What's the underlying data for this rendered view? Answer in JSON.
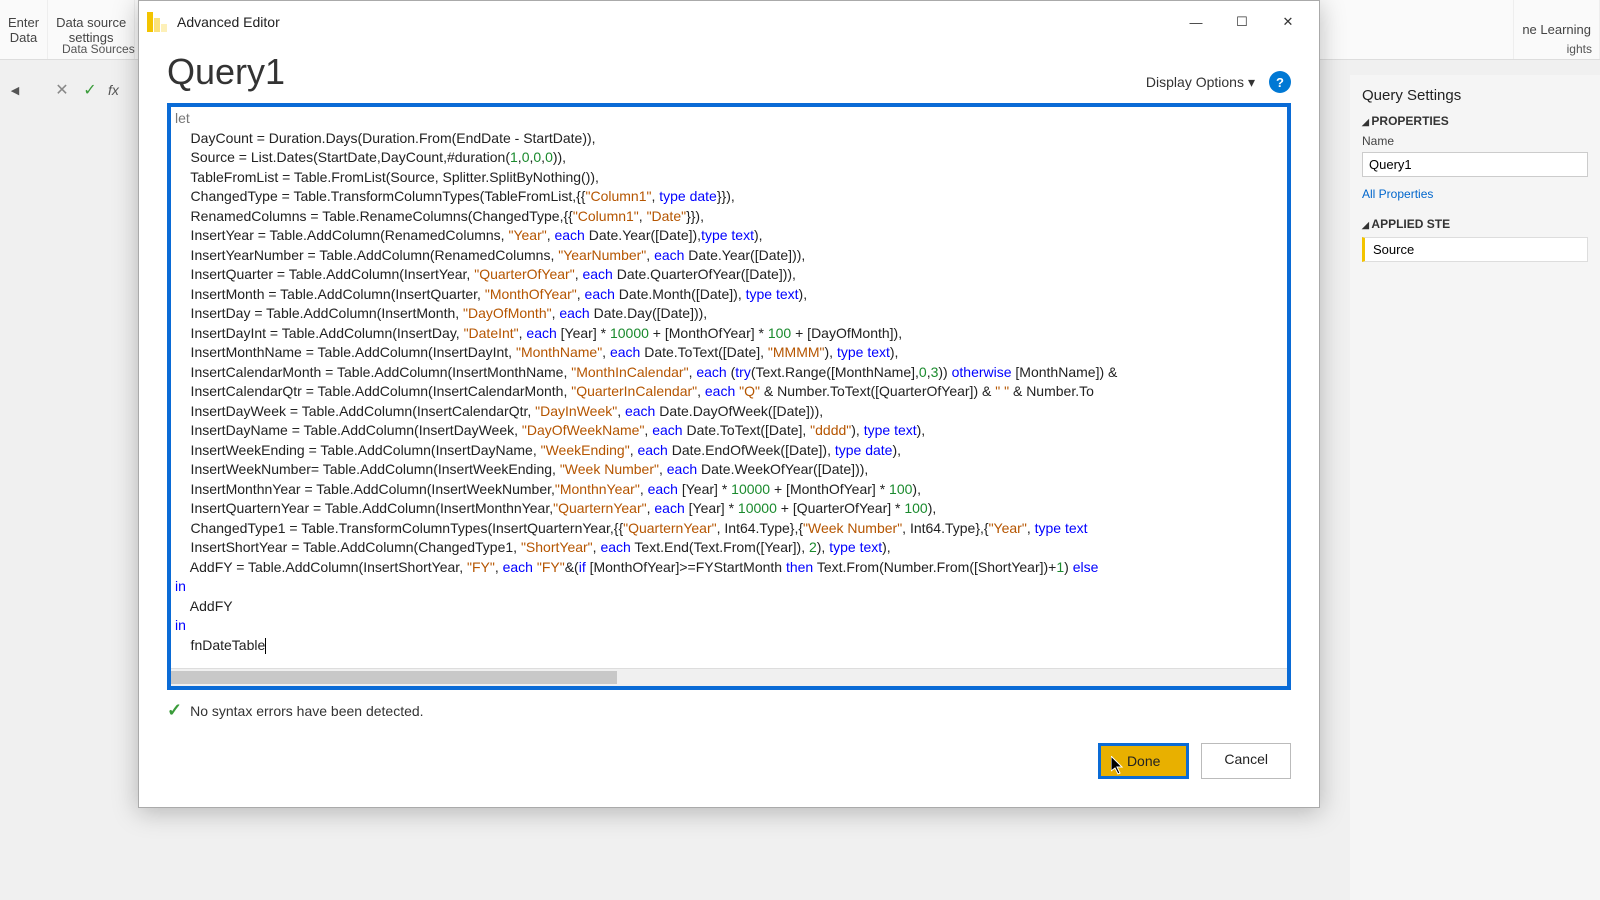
{
  "ribbon": {
    "enter_data": "Enter\nData",
    "data_source_settings": "Data source\nsettings",
    "data_sources": "Data Sources",
    "machine_learning": "ne Learning",
    "ights": "ights"
  },
  "right_panel": {
    "title": "Query Settings",
    "properties": "PROPERTIES",
    "name_label": "Name",
    "name_value": "Query1",
    "all_props": "All Properties",
    "applied_steps": "APPLIED STE",
    "step1": "Source"
  },
  "dialog": {
    "title": "Advanced Editor",
    "query_name": "Query1",
    "display_options": "Display Options",
    "status": "No syntax errors have been detected.",
    "done": "Done",
    "cancel": "Cancel"
  },
  "code": {
    "lines": [
      {
        "raw": "let",
        "cls": "kw",
        "indent": 0,
        "faded": true
      },
      {
        "indent": 2,
        "segs": [
          [
            "    DayCount = Duration.Days(Duration.From(EndDate - StartDate)),",
            ""
          ]
        ]
      },
      {
        "indent": 2,
        "segs": [
          [
            "    Source = List.Dates(StartDate,DayCount,#duration(",
            ""
          ],
          [
            "1",
            "num"
          ],
          [
            ",",
            ""
          ],
          [
            "0",
            "num"
          ],
          [
            ",",
            ""
          ],
          [
            "0",
            "num"
          ],
          [
            ",",
            ""
          ],
          [
            "0",
            "num"
          ],
          [
            ")),",
            ""
          ]
        ]
      },
      {
        "indent": 2,
        "segs": [
          [
            "    TableFromList = Table.FromList(Source, Splitter.SplitByNothing()),",
            ""
          ]
        ]
      },
      {
        "indent": 2,
        "segs": [
          [
            "    ChangedType = Table.TransformColumnTypes(TableFromList,{{",
            ""
          ],
          [
            "\"Column1\"",
            "str"
          ],
          [
            ", ",
            ""
          ],
          [
            "type date",
            "kw"
          ],
          [
            "}}),",
            ""
          ]
        ]
      },
      {
        "indent": 2,
        "segs": [
          [
            "    RenamedColumns = Table.RenameColumns(ChangedType,{{",
            ""
          ],
          [
            "\"Column1\"",
            "str"
          ],
          [
            ", ",
            ""
          ],
          [
            "\"Date\"",
            "str"
          ],
          [
            "}}),",
            ""
          ]
        ]
      },
      {
        "indent": 2,
        "segs": [
          [
            "    InsertYear = Table.AddColumn(RenamedColumns, ",
            ""
          ],
          [
            "\"Year\"",
            "str"
          ],
          [
            ", ",
            ""
          ],
          [
            "each",
            "kw"
          ],
          [
            " Date.Year([Date]),",
            ""
          ],
          [
            "type text",
            "kw"
          ],
          [
            "),",
            ""
          ]
        ]
      },
      {
        "indent": 2,
        "segs": [
          [
            "    InsertYearNumber = Table.AddColumn(RenamedColumns, ",
            ""
          ],
          [
            "\"YearNumber\"",
            "str"
          ],
          [
            ", ",
            ""
          ],
          [
            "each",
            "kw"
          ],
          [
            " Date.Year([Date])),",
            ""
          ]
        ]
      },
      {
        "indent": 2,
        "segs": [
          [
            "    InsertQuarter = Table.AddColumn(InsertYear, ",
            ""
          ],
          [
            "\"QuarterOfYear\"",
            "str"
          ],
          [
            ", ",
            ""
          ],
          [
            "each",
            "kw"
          ],
          [
            " Date.QuarterOfYear([Date])),",
            ""
          ]
        ]
      },
      {
        "indent": 2,
        "segs": [
          [
            "    InsertMonth = Table.AddColumn(InsertQuarter, ",
            ""
          ],
          [
            "\"MonthOfYear\"",
            "str"
          ],
          [
            ", ",
            ""
          ],
          [
            "each",
            "kw"
          ],
          [
            " Date.Month([Date]), ",
            ""
          ],
          [
            "type text",
            "kw"
          ],
          [
            "),",
            ""
          ]
        ]
      },
      {
        "indent": 2,
        "segs": [
          [
            "    InsertDay = Table.AddColumn(InsertMonth, ",
            ""
          ],
          [
            "\"DayOfMonth\"",
            "str"
          ],
          [
            ", ",
            ""
          ],
          [
            "each",
            "kw"
          ],
          [
            " Date.Day([Date])),",
            ""
          ]
        ]
      },
      {
        "indent": 2,
        "segs": [
          [
            "    InsertDayInt = Table.AddColumn(InsertDay, ",
            ""
          ],
          [
            "\"DateInt\"",
            "str"
          ],
          [
            ", ",
            ""
          ],
          [
            "each",
            "kw"
          ],
          [
            " [Year] * ",
            ""
          ],
          [
            "10000",
            "num"
          ],
          [
            " + [MonthOfYear] * ",
            ""
          ],
          [
            "100",
            "num"
          ],
          [
            " + [DayOfMonth]),",
            ""
          ]
        ]
      },
      {
        "indent": 2,
        "segs": [
          [
            "    InsertMonthName = Table.AddColumn(InsertDayInt, ",
            ""
          ],
          [
            "\"MonthName\"",
            "str"
          ],
          [
            ", ",
            ""
          ],
          [
            "each",
            "kw"
          ],
          [
            " Date.ToText([Date], ",
            ""
          ],
          [
            "\"MMMM\"",
            "str"
          ],
          [
            "), ",
            ""
          ],
          [
            "type text",
            "kw"
          ],
          [
            "),",
            ""
          ]
        ]
      },
      {
        "indent": 2,
        "segs": [
          [
            "    InsertCalendarMonth = Table.AddColumn(InsertMonthName, ",
            ""
          ],
          [
            "\"MonthInCalendar\"",
            "str"
          ],
          [
            ", ",
            ""
          ],
          [
            "each",
            "kw"
          ],
          [
            " (",
            ""
          ],
          [
            "try",
            "kw"
          ],
          [
            "(Text.Range([MonthName],",
            ""
          ],
          [
            "0",
            "num"
          ],
          [
            ",",
            ""
          ],
          [
            "3",
            "num"
          ],
          [
            ")) ",
            ""
          ],
          [
            "otherwise",
            "kw"
          ],
          [
            " [MonthName]) &",
            ""
          ]
        ]
      },
      {
        "indent": 2,
        "segs": [
          [
            "    InsertCalendarQtr = Table.AddColumn(InsertCalendarMonth, ",
            ""
          ],
          [
            "\"QuarterInCalendar\"",
            "str"
          ],
          [
            ", ",
            ""
          ],
          [
            "each",
            "kw"
          ],
          [
            " ",
            ""
          ],
          [
            "\"Q\"",
            "str"
          ],
          [
            " & Number.ToText([QuarterOfYear]) & ",
            ""
          ],
          [
            "\" \"",
            "str"
          ],
          [
            " & Number.To",
            ""
          ]
        ]
      },
      {
        "indent": 2,
        "segs": [
          [
            "    InsertDayWeek = Table.AddColumn(InsertCalendarQtr, ",
            ""
          ],
          [
            "\"DayInWeek\"",
            "str"
          ],
          [
            ", ",
            ""
          ],
          [
            "each",
            "kw"
          ],
          [
            " Date.DayOfWeek([Date])),",
            ""
          ]
        ]
      },
      {
        "indent": 2,
        "segs": [
          [
            "    InsertDayName = Table.AddColumn(InsertDayWeek, ",
            ""
          ],
          [
            "\"DayOfWeekName\"",
            "str"
          ],
          [
            ", ",
            ""
          ],
          [
            "each",
            "kw"
          ],
          [
            " Date.ToText([Date], ",
            ""
          ],
          [
            "\"dddd\"",
            "str"
          ],
          [
            "), ",
            ""
          ],
          [
            "type text",
            "kw"
          ],
          [
            "),",
            ""
          ]
        ]
      },
      {
        "indent": 2,
        "segs": [
          [
            "    InsertWeekEnding = Table.AddColumn(InsertDayName, ",
            ""
          ],
          [
            "\"WeekEnding\"",
            "str"
          ],
          [
            ", ",
            ""
          ],
          [
            "each",
            "kw"
          ],
          [
            " Date.EndOfWeek([Date]), ",
            ""
          ],
          [
            "type date",
            "kw"
          ],
          [
            "),",
            ""
          ]
        ]
      },
      {
        "indent": 2,
        "segs": [
          [
            "    InsertWeekNumber= Table.AddColumn(InsertWeekEnding, ",
            ""
          ],
          [
            "\"Week Number\"",
            "str"
          ],
          [
            ", ",
            ""
          ],
          [
            "each",
            "kw"
          ],
          [
            " Date.WeekOfYear([Date])),",
            ""
          ]
        ]
      },
      {
        "indent": 2,
        "segs": [
          [
            "    InsertMonthnYear = Table.AddColumn(InsertWeekNumber,",
            ""
          ],
          [
            "\"MonthnYear\"",
            "str"
          ],
          [
            ", ",
            ""
          ],
          [
            "each",
            "kw"
          ],
          [
            " [Year] * ",
            ""
          ],
          [
            "10000",
            "num"
          ],
          [
            " + [MonthOfYear] * ",
            ""
          ],
          [
            "100",
            "num"
          ],
          [
            "),",
            ""
          ]
        ]
      },
      {
        "indent": 2,
        "segs": [
          [
            "    InsertQuarternYear = Table.AddColumn(InsertMonthnYear,",
            ""
          ],
          [
            "\"QuarternYear\"",
            "str"
          ],
          [
            ", ",
            ""
          ],
          [
            "each",
            "kw"
          ],
          [
            " [Year] * ",
            ""
          ],
          [
            "10000",
            "num"
          ],
          [
            " + [QuarterOfYear] * ",
            ""
          ],
          [
            "100",
            "num"
          ],
          [
            "),",
            ""
          ]
        ]
      },
      {
        "indent": 2,
        "segs": [
          [
            "    ChangedType1 = Table.TransformColumnTypes(InsertQuarternYear,{{",
            ""
          ],
          [
            "\"QuarternYear\"",
            "str"
          ],
          [
            ", Int64.Type},{",
            ""
          ],
          [
            "\"Week Number\"",
            "str"
          ],
          [
            ", Int64.Type},{",
            ""
          ],
          [
            "\"Year\"",
            "str"
          ],
          [
            ", ",
            ""
          ],
          [
            "type text",
            "kw"
          ]
        ]
      },
      {
        "indent": 2,
        "segs": [
          [
            "    InsertShortYear = Table.AddColumn(ChangedType1, ",
            ""
          ],
          [
            "\"ShortYear\"",
            "str"
          ],
          [
            ", ",
            ""
          ],
          [
            "each",
            "kw"
          ],
          [
            " Text.End(Text.From([Year]), ",
            ""
          ],
          [
            "2",
            "num"
          ],
          [
            "), ",
            ""
          ],
          [
            "type text",
            "kw"
          ],
          [
            "),",
            ""
          ]
        ]
      },
      {
        "indent": 2,
        "segs": [
          [
            "    AddFY = Table.AddColumn(InsertShortYear, ",
            ""
          ],
          [
            "\"FY\"",
            "str"
          ],
          [
            ", ",
            ""
          ],
          [
            "each",
            "kw"
          ],
          [
            " ",
            ""
          ],
          [
            "\"FY\"",
            "str"
          ],
          [
            "&(",
            ""
          ],
          [
            "if",
            "kw"
          ],
          [
            " [MonthOfYear]>=FYStartMonth ",
            ""
          ],
          [
            "then",
            "kw"
          ],
          [
            " Text.From(Number.From([ShortYear])+",
            ""
          ],
          [
            "1",
            "num"
          ],
          [
            ") ",
            ""
          ],
          [
            "else",
            "kw"
          ]
        ]
      },
      {
        "indent": 0,
        "segs": [
          [
            "in",
            "kw"
          ]
        ]
      },
      {
        "indent": 2,
        "segs": [
          [
            "    AddFY",
            ""
          ]
        ]
      },
      {
        "indent": 0,
        "segs": [
          [
            "in",
            "kw"
          ]
        ]
      },
      {
        "indent": 2,
        "segs": [
          [
            "    fnDateTable",
            ""
          ]
        ],
        "cursor": true
      }
    ]
  }
}
